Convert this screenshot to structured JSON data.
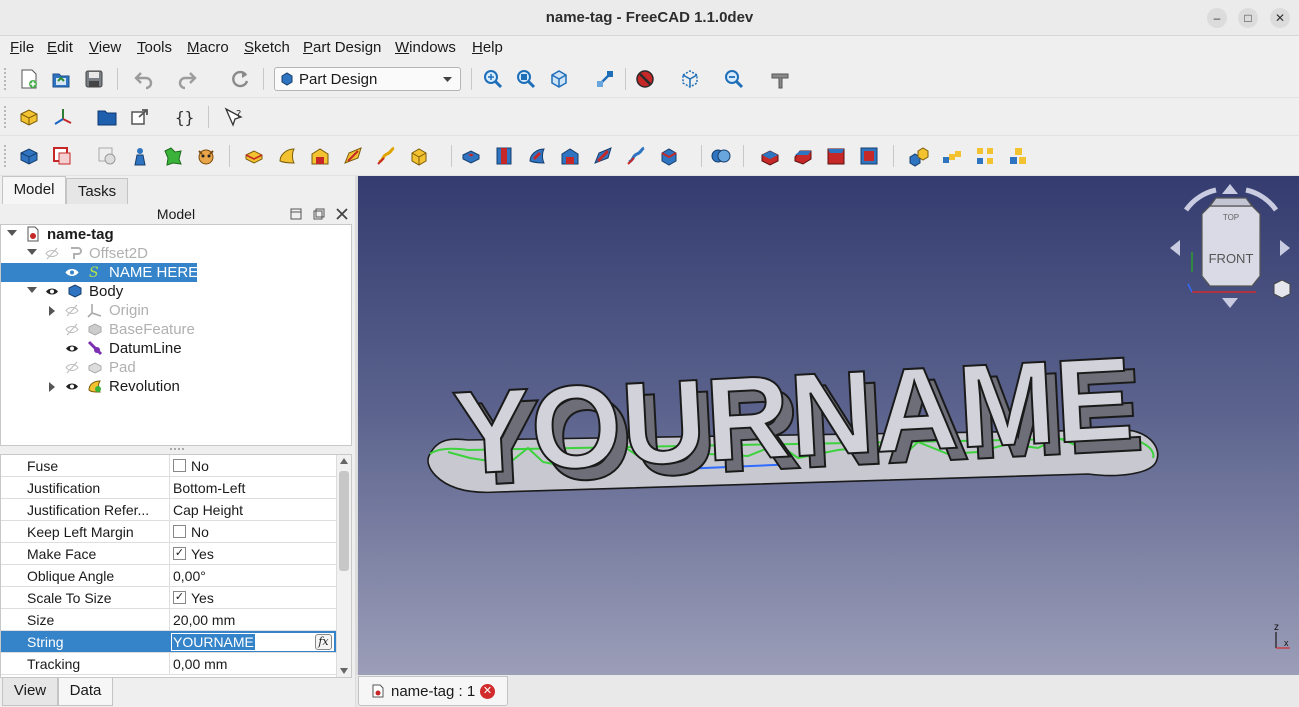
{
  "window": {
    "title": "name-tag - FreeCAD 1.1.0dev"
  },
  "menu": [
    "File",
    "Edit",
    "View",
    "Tools",
    "Macro",
    "Sketch",
    "Part Design",
    "Windows",
    "Help"
  ],
  "workbench": {
    "selected": "Part Design"
  },
  "panel": {
    "tabs": [
      "Model",
      "Tasks"
    ],
    "header": "Model",
    "bottom_tabs": [
      "View",
      "Data"
    ]
  },
  "tree": {
    "root": "name-tag",
    "items": [
      {
        "label": "Offset2D"
      },
      {
        "label": "NAME HERE"
      },
      {
        "label": "Body"
      },
      {
        "label": "Origin"
      },
      {
        "label": "BaseFeature"
      },
      {
        "label": "DatumLine"
      },
      {
        "label": "Pad"
      },
      {
        "label": "Revolution"
      }
    ]
  },
  "properties": [
    {
      "name": "Fuse",
      "value": "No",
      "checkbox": "unchecked"
    },
    {
      "name": "Justification",
      "value": "Bottom-Left"
    },
    {
      "name": "Justification Refer...",
      "value": "Cap Height"
    },
    {
      "name": "Keep Left Margin",
      "value": "No",
      "checkbox": "unchecked"
    },
    {
      "name": "Make Face",
      "value": "Yes",
      "checkbox": "checked"
    },
    {
      "name": "Oblique Angle",
      "value": "0,00°"
    },
    {
      "name": "Scale To Size",
      "value": "Yes",
      "checkbox": "checked"
    },
    {
      "name": "Size",
      "value": "20,00 mm"
    },
    {
      "name": "String",
      "value": "YOURNAME"
    },
    {
      "name": "Tracking",
      "value": "0,00 mm"
    }
  ],
  "viewport": {
    "text": "YOURNAME",
    "navcube": {
      "top": "TOP",
      "front": "FRONT"
    },
    "axis_z": "z",
    "axis_x": "x"
  },
  "document_tab": {
    "label": "name-tag : 1"
  },
  "colors": {
    "selection": "#3584c9",
    "accent_blue": "#2f74c0",
    "close_red": "#d22b2b"
  }
}
